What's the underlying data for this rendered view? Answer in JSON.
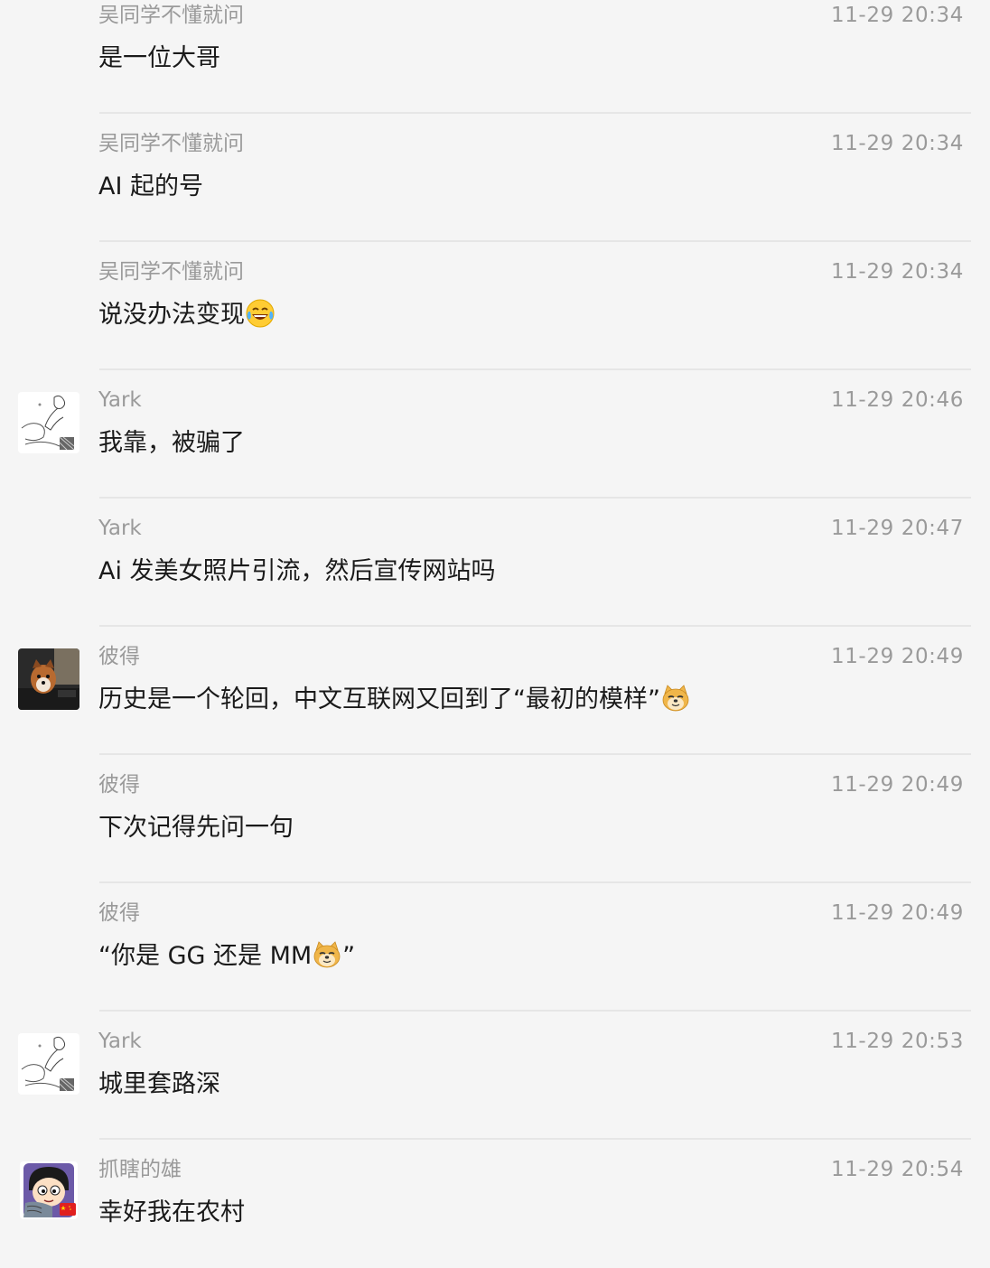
{
  "messages": [
    {
      "sender": "吴同学不懂就问",
      "time": "11-29 20:34",
      "text": "是一位大哥",
      "emoji": null,
      "avatar": null
    },
    {
      "sender": "吴同学不懂就问",
      "time": "11-29 20:34",
      "text": "AI 起的号",
      "emoji": null,
      "avatar": null
    },
    {
      "sender": "吴同学不懂就问",
      "time": "11-29 20:34",
      "text": "说没办法变现",
      "emoji": "laughing-tears-emoji",
      "avatar": null
    },
    {
      "sender": "Yark",
      "time": "11-29 20:46",
      "text": "我靠，被骗了",
      "emoji": null,
      "avatar": "sketch-avatar"
    },
    {
      "sender": "Yark",
      "time": "11-29 20:47",
      "text": "Ai 发美女照片引流，然后宣传网站吗",
      "emoji": null,
      "avatar": null
    },
    {
      "sender": "彼得",
      "time": "11-29 20:49",
      "text": "历史是一个轮回，中文互联网又回到了“最初的模样”",
      "emoji": "doge-emoji",
      "avatar": "dog-photo-avatar"
    },
    {
      "sender": "彼得",
      "time": "11-29 20:49",
      "text": "下次记得先问一句",
      "emoji": null,
      "avatar": null
    },
    {
      "sender": "彼得",
      "time": "11-29 20:49",
      "text_before": "“你是 GG 还是 MM",
      "text_after": "”",
      "emoji": "doge-emoji",
      "avatar": null
    },
    {
      "sender": "Yark",
      "time": "11-29 20:53",
      "text": "城里套路深",
      "emoji": null,
      "avatar": "sketch-avatar"
    },
    {
      "sender": "抓瞎的雄",
      "time": "11-29 20:54",
      "text": "幸好我在农村",
      "emoji": null,
      "avatar": "cartoon-boy-avatar"
    }
  ],
  "colors": {
    "background": "#f5f5f5",
    "divider": "#e6e6e6",
    "meta_text": "#9a9a9a",
    "message_text": "#1a1a1a"
  }
}
